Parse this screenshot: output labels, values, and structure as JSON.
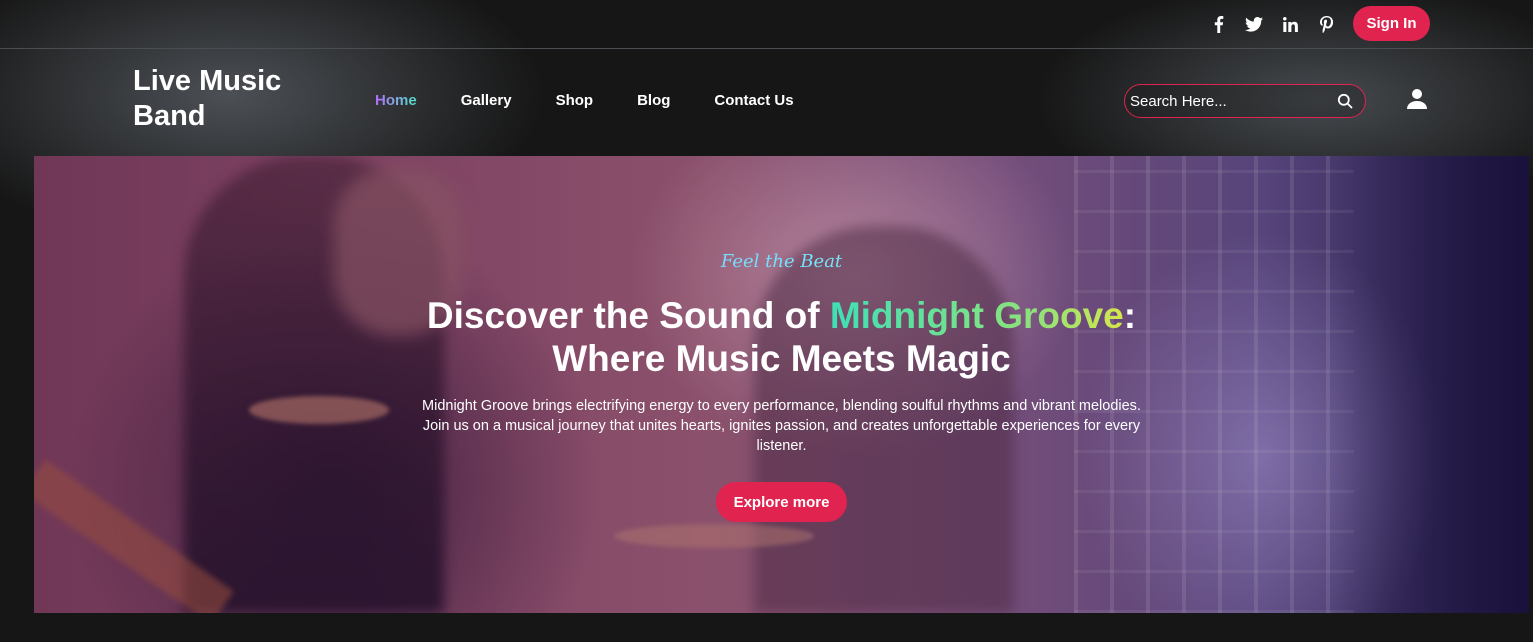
{
  "topbar": {
    "socials": [
      {
        "icon": "facebook-icon"
      },
      {
        "icon": "twitter-icon"
      },
      {
        "icon": "linkedin-icon"
      },
      {
        "icon": "pinterest-icon"
      }
    ],
    "signin_label": "Sign In"
  },
  "header": {
    "logo_line1": "Live Music",
    "logo_line2": "Band",
    "nav": [
      {
        "label": "Home",
        "active": true
      },
      {
        "label": "Gallery",
        "active": false
      },
      {
        "label": "Shop",
        "active": false
      },
      {
        "label": "Blog",
        "active": false
      },
      {
        "label": "Contact Us",
        "active": false
      }
    ],
    "search": {
      "placeholder": "Search Here..."
    },
    "user_icon": "user-icon"
  },
  "hero": {
    "tagline": "Feel the Beat",
    "headline_part1": "Discover the Sound of ",
    "headline_highlight": "Midnight Groove",
    "headline_part2": ":",
    "headline_line2": "Where Music Meets Magic",
    "description": "Midnight Groove brings electrifying energy to every performance, blending soulful rhythms and vibrant melodies. Join us on a musical journey that unites hearts, ignites passion, and creates unforgettable experiences for every listener.",
    "cta_label": "Explore more"
  },
  "colors": {
    "accent": "#e0244f",
    "background": "#141414"
  }
}
